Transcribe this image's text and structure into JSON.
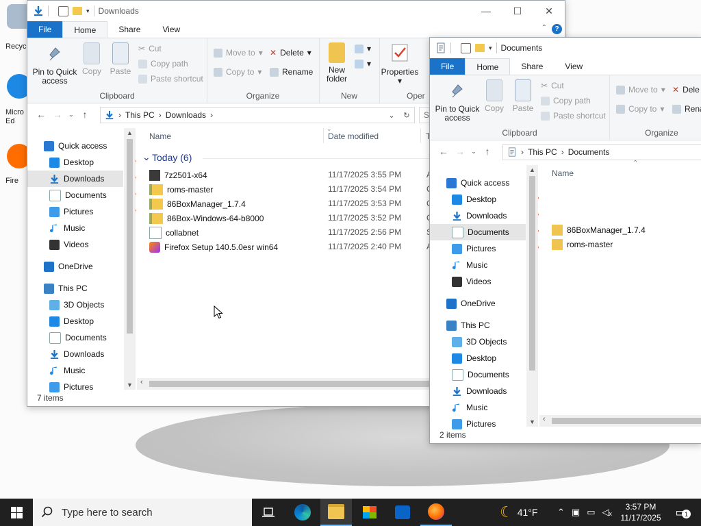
{
  "desktop": {
    "icons": [
      {
        "label": "Recyc",
        "color": "#9ab0c6"
      },
      {
        "label": "Micro\nEd",
        "color": "#1e88e5"
      },
      {
        "label": "Fire",
        "color": "#ff6d00"
      }
    ]
  },
  "left_window": {
    "title": "Downloads",
    "tabs": {
      "file": "File",
      "home": "Home",
      "share": "Share",
      "view": "View"
    },
    "ribbon": {
      "pin": "Pin to Quick access",
      "copy": "Copy",
      "paste": "Paste",
      "cut": "Cut",
      "copy_path": "Copy path",
      "paste_shortcut": "Paste shortcut",
      "clipboard": "Clipboard",
      "move_to": "Move to",
      "copy_to": "Copy to",
      "delete": "Delete",
      "rename": "Rename",
      "organize": "Organize",
      "new_folder": "New folder",
      "new": "New",
      "properties": "Properties",
      "open": "Oper"
    },
    "address": {
      "this_pc": "This PC",
      "folder": "Downloads",
      "search": "Se"
    },
    "nav": [
      {
        "label": "Quick access",
        "icon": "star-icon",
        "indent": 0
      },
      {
        "label": "Desktop",
        "icon": "desktop-icon",
        "indent": 1,
        "pin": true
      },
      {
        "label": "Downloads",
        "icon": "download-icon",
        "indent": 1,
        "pin": true,
        "state": "hl"
      },
      {
        "label": "Documents",
        "icon": "document-icon",
        "indent": 1,
        "pin": true
      },
      {
        "label": "Pictures",
        "icon": "pictures-icon",
        "indent": 1,
        "pin": true
      },
      {
        "label": "Music",
        "icon": "music-icon",
        "indent": 1
      },
      {
        "label": "Videos",
        "icon": "videos-icon",
        "indent": 1
      },
      {
        "label": "OneDrive",
        "icon": "onedrive-icon",
        "indent": 0,
        "gap": true
      },
      {
        "label": "This PC",
        "icon": "this-pc-icon",
        "indent": 0,
        "gap": true
      },
      {
        "label": "3D Objects",
        "icon": "3d-objects-icon",
        "indent": 1
      },
      {
        "label": "Desktop",
        "icon": "desktop-icon",
        "indent": 1
      },
      {
        "label": "Documents",
        "icon": "document-icon",
        "indent": 1
      },
      {
        "label": "Downloads",
        "icon": "download-icon",
        "indent": 1
      },
      {
        "label": "Music",
        "icon": "music-icon",
        "indent": 1
      },
      {
        "label": "Pictures",
        "icon": "pictures-icon",
        "indent": 1
      }
    ],
    "columns": {
      "name": "Name",
      "date": "Date modified",
      "type": "T"
    },
    "group": "Today (6)",
    "files": [
      {
        "name": "7z2501-x64",
        "date": "11/17/2025 3:55 PM",
        "type": "A",
        "icon": "exe-icon"
      },
      {
        "name": "roms-master",
        "date": "11/17/2025 3:54 PM",
        "type": "C",
        "icon": "zip-icon"
      },
      {
        "name": "86BoxManager_1.7.4",
        "date": "11/17/2025 3:53 PM",
        "type": "C",
        "icon": "zip-icon"
      },
      {
        "name": "86Box-Windows-64-b8000",
        "date": "11/17/2025 3:52 PM",
        "type": "C",
        "icon": "zip-icon"
      },
      {
        "name": "collabnet",
        "date": "11/17/2025 2:56 PM",
        "type": "S",
        "icon": "shortcut-icon"
      },
      {
        "name": "Firefox Setup 140.5.0esr win64",
        "date": "11/17/2025 2:40 PM",
        "type": "A",
        "icon": "installer-icon"
      }
    ],
    "status": "7 items"
  },
  "right_window": {
    "title": "Documents",
    "tabs": {
      "file": "File",
      "home": "Home",
      "share": "Share",
      "view": "View"
    },
    "ribbon": {
      "pin": "Pin to Quick access",
      "copy": "Copy",
      "paste": "Paste",
      "cut": "Cut",
      "copy_path": "Copy path",
      "paste_shortcut": "Paste shortcut",
      "clipboard": "Clipboard",
      "move_to": "Move to",
      "copy_to": "Copy to",
      "delete": "Dele",
      "rename": "Rena",
      "organize": "Organize"
    },
    "address": {
      "this_pc": "This PC",
      "folder": "Documents"
    },
    "nav": [
      {
        "label": "Quick access",
        "icon": "star-icon",
        "indent": 0
      },
      {
        "label": "Desktop",
        "icon": "desktop-icon",
        "indent": 1,
        "pin": true
      },
      {
        "label": "Downloads",
        "icon": "download-icon",
        "indent": 1,
        "pin": true
      },
      {
        "label": "Documents",
        "icon": "document-icon",
        "indent": 1,
        "pin": true,
        "state": "hl"
      },
      {
        "label": "Pictures",
        "icon": "pictures-icon",
        "indent": 1,
        "pin": true
      },
      {
        "label": "Music",
        "icon": "music-icon",
        "indent": 1
      },
      {
        "label": "Videos",
        "icon": "videos-icon",
        "indent": 1
      },
      {
        "label": "OneDrive",
        "icon": "onedrive-icon",
        "indent": 0,
        "gap": true
      },
      {
        "label": "This PC",
        "icon": "this-pc-icon",
        "indent": 0,
        "gap": true
      },
      {
        "label": "3D Objects",
        "icon": "3d-objects-icon",
        "indent": 1
      },
      {
        "label": "Desktop",
        "icon": "desktop-icon",
        "indent": 1
      },
      {
        "label": "Documents",
        "icon": "document-icon",
        "indent": 1
      },
      {
        "label": "Downloads",
        "icon": "download-icon",
        "indent": 1
      },
      {
        "label": "Music",
        "icon": "music-icon",
        "indent": 1
      },
      {
        "label": "Pictures",
        "icon": "pictures-icon",
        "indent": 1
      }
    ],
    "columns": {
      "name": "Name"
    },
    "files": [
      {
        "name": "86BoxManager_1.7.4",
        "icon": "folder-icon"
      },
      {
        "name": "roms-master",
        "icon": "folder-icon"
      }
    ],
    "status": "2 items"
  },
  "taskbar": {
    "search_placeholder": "Type here to search",
    "weather": "41°F",
    "time": "3:57 PM",
    "date": "11/17/2025",
    "notification_count": "1"
  },
  "colors": {
    "accent": "#1a73c8",
    "taskbar": "#202020",
    "selection": "#cce4f7"
  }
}
